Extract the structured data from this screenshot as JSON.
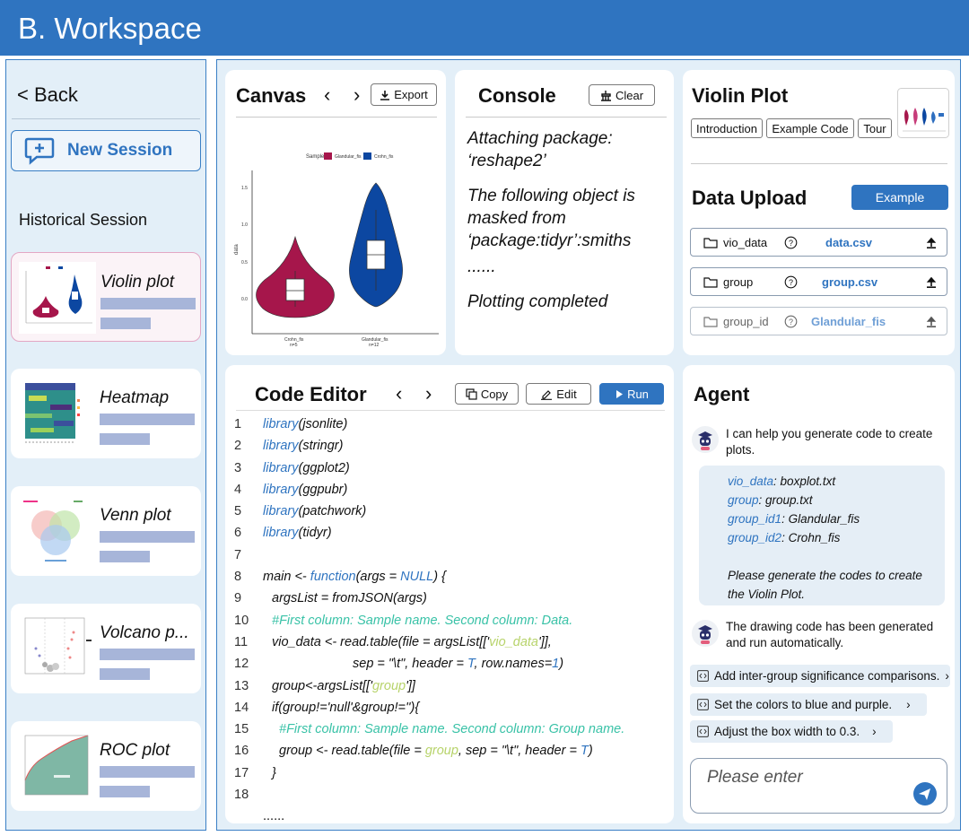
{
  "window": {
    "title": "B. Workspace"
  },
  "sidebar": {
    "back_label": "Back",
    "new_session_label": "New Session",
    "history_label": "Historical Session",
    "sessions": [
      {
        "name": "Violin plot"
      },
      {
        "name": "Heatmap"
      },
      {
        "name": "Venn plot"
      },
      {
        "name": "Volcano p..."
      },
      {
        "name": "ROC plot"
      }
    ]
  },
  "canvas": {
    "title": "Canvas",
    "export_label": "Export",
    "legend_title": "Sample",
    "legend_items": [
      "Glandular_fis",
      "Crohn_fis"
    ],
    "y_label": "data",
    "y_ticks": [
      "0.0",
      "0.5",
      "1.0",
      "1.5"
    ],
    "x_categories": [
      "Crohn_fis",
      "Glandular_fis"
    ],
    "x_counts": [
      "n=5",
      "n=12"
    ]
  },
  "console": {
    "title": "Console",
    "clear_label": "Clear",
    "lines": [
      "Attaching package: ‘reshape2’",
      "The following object is masked from ‘package:tidyr’:smiths",
      "......",
      "Plotting completed"
    ]
  },
  "plot_info": {
    "title": "Violin Plot",
    "tabs": [
      "Introduction",
      "Example Code",
      "Tour"
    ]
  },
  "data_upload": {
    "title": "Data Upload",
    "example_label": "Example",
    "files": [
      {
        "field": "vio_data",
        "file": "data.csv"
      },
      {
        "field": "group",
        "file": "group.csv"
      },
      {
        "field": "group_id",
        "file": "Glandular_fis"
      }
    ]
  },
  "code_editor": {
    "title": "Code Editor",
    "copy_label": "Copy",
    "edit_label": "Edit",
    "run_label": "Run",
    "line_numbers": [
      "1",
      "2",
      "3",
      "4",
      "5",
      "6",
      "7",
      "8",
      "9",
      "10",
      "11",
      "12",
      "13",
      "14",
      "15",
      "16",
      "17",
      "18"
    ],
    "library_fn": "library",
    "libraries": [
      "(jsonlite)",
      "(stringr)",
      "(ggplot2)",
      "(ggpubr)",
      "(patchwork)",
      "(tidyr)"
    ],
    "line8": [
      "main <- ",
      "function",
      "(args = ",
      "NULL",
      ") {"
    ],
    "line9": "argsList = fromJSON(args)",
    "line10": "#First column: Sample name. Second column: Data.",
    "line11": [
      "vio_data <- read.table(file = argsList[['",
      "vio_data",
      "']],"
    ],
    "line12": [
      "sep = \"\\t\", header = ",
      "T",
      ", row.names=",
      "1",
      ")"
    ],
    "line13": [
      "group<-argsList[['",
      "group",
      "']]"
    ],
    "line14": "if(group!='null'&group!=''){",
    "line15": "#First column: Sample name. Second column: Group name.",
    "line16": [
      "group <- read.table(file = ",
      "group",
      ", sep = \"\\t\", header = ",
      "T",
      ")"
    ],
    "line17": "}",
    "ellipsis": "......"
  },
  "agent": {
    "title": "Agent",
    "intro": "I can help you generate code to create plots.",
    "request": [
      {
        "key": "vio_data",
        "value": ": boxplot.txt"
      },
      {
        "key": "group",
        "value": ": group.txt"
      },
      {
        "key": "group_id1",
        "value": ": Glandular_fis"
      },
      {
        "key": "group_id2",
        "value": ": Crohn_fis"
      }
    ],
    "request_text": "Please generate the codes to create the Violin Plot.",
    "reply": "The drawing code has been generated and run automatically.",
    "suggestions": [
      "Add inter-group significance comparisons.",
      "Set the colors to blue and purple.",
      "Adjust the box width to 0.3."
    ],
    "input_placeholder": "Please enter"
  }
}
